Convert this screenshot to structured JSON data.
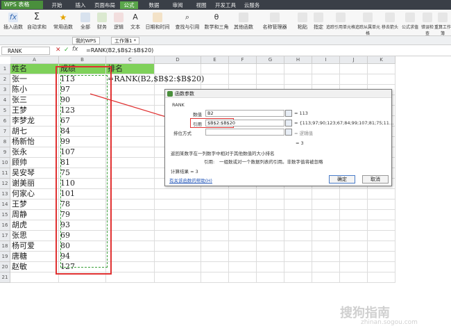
{
  "app": {
    "name": "WPS 表格"
  },
  "menu_tabs": [
    "开始",
    "插入",
    "页面布局",
    "公式",
    "数据",
    "审阅",
    "视图",
    "开发工具",
    "云服务"
  ],
  "active_menu": "公式",
  "ribbon": {
    "items": [
      "插入函数",
      "自动求和",
      "常用函数",
      "全部",
      "财务",
      "逻辑",
      "文本",
      "日期和时间",
      "查找与引用",
      "数学和三角",
      "其他函数",
      "名称管理器",
      "粘贴",
      "指定",
      "追踪引用单元格",
      "追踪从属单元格",
      "移去箭头",
      "公式求值",
      "错误检查",
      "重算工作簿"
    ]
  },
  "doc_tabs": [
    "我的WPS",
    "工作簿1 *"
  ],
  "formula_bar": {
    "name_box": "RANK",
    "formula": "=RANK(B2,$B$2:$B$20)"
  },
  "columns": [
    "A",
    "B",
    "C",
    "D",
    "E",
    "F",
    "G",
    "H",
    "I",
    "J",
    "K"
  ],
  "rows": [
    {
      "num": "1",
      "a": "姓名",
      "b": "成绩",
      "c": "排名"
    },
    {
      "num": "2",
      "a": "张一",
      "b": "113",
      "c": "=RANK(B2,$B$2:$B$20)"
    },
    {
      "num": "3",
      "a": "陈小",
      "b": "97",
      "c": ""
    },
    {
      "num": "4",
      "a": "张三",
      "b": "90",
      "c": ""
    },
    {
      "num": "5",
      "a": "王梦",
      "b": "123",
      "c": ""
    },
    {
      "num": "6",
      "a": "李梦龙",
      "b": "67",
      "c": ""
    },
    {
      "num": "7",
      "a": "胡七",
      "b": "84",
      "c": ""
    },
    {
      "num": "8",
      "a": "杨新怡",
      "b": "99",
      "c": ""
    },
    {
      "num": "9",
      "a": "张永",
      "b": "107",
      "c": ""
    },
    {
      "num": "10",
      "a": "顾帅",
      "b": "81",
      "c": ""
    },
    {
      "num": "11",
      "a": "吴安琴",
      "b": "75",
      "c": ""
    },
    {
      "num": "12",
      "a": "谢美丽",
      "b": "110",
      "c": ""
    },
    {
      "num": "13",
      "a": "何家心",
      "b": "101",
      "c": ""
    },
    {
      "num": "14",
      "a": "王梦",
      "b": "78",
      "c": ""
    },
    {
      "num": "15",
      "a": "周静",
      "b": "79",
      "c": ""
    },
    {
      "num": "16",
      "a": "胡虎",
      "b": "93",
      "c": ""
    },
    {
      "num": "17",
      "a": "张思",
      "b": "69",
      "c": ""
    },
    {
      "num": "18",
      "a": "杨可爱",
      "b": "80",
      "c": ""
    },
    {
      "num": "19",
      "a": "唐糖",
      "b": "94",
      "c": ""
    },
    {
      "num": "20",
      "a": "赵敏",
      "b": "127",
      "c": ""
    },
    {
      "num": "21",
      "a": "",
      "b": "",
      "c": ""
    }
  ],
  "dialog": {
    "title": "函数参数",
    "func_name": "RANK",
    "arg1_label": "数值",
    "arg1_value": "B2",
    "arg1_result": "= 113",
    "arg2_label": "引用",
    "arg2_value": "$B$2:$B$20",
    "arg2_result": "= {113;97;90;123;67;84;99;107;81;75;11…",
    "arg3_label": "排位方式",
    "arg3_result": "= 逻辑值",
    "eq_result": "= 3",
    "desc": "返回某数字在一列数字中相对于其他数值的大小排名",
    "ref_label": "引用:",
    "ref_desc": "一组数或对一个数据列表的引用。非数字值将被忽略",
    "calc_result": "计算结果 = 3",
    "help_link": "有关该函数的帮助(H)",
    "ok": "确定",
    "cancel": "取消"
  },
  "colors": {
    "accent_green": "#4a8f3c",
    "header_fill": "#7fd15a",
    "red_box": "#e03030"
  }
}
